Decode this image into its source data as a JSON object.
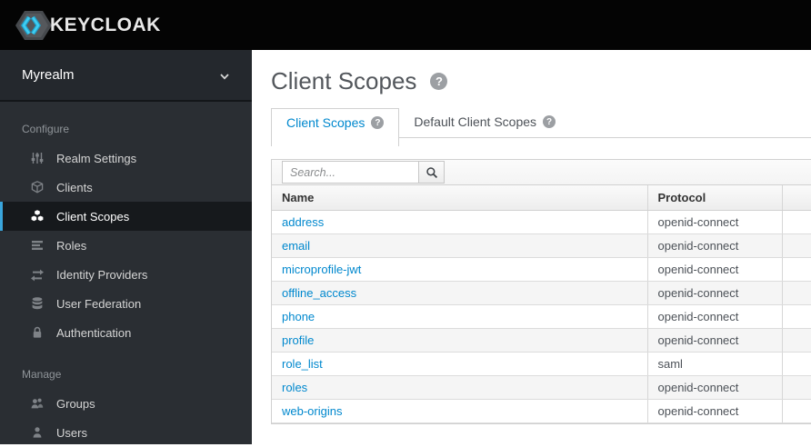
{
  "colors": {
    "accent": "#0088ce",
    "indicator": "#39a5dc",
    "brand_cyan": "#2cc1e9",
    "topbar_bg": "#040404",
    "sidebar_bg": "#2a2e33"
  },
  "topbar": {
    "brand": "KEYCLOAK",
    "logo_icon": "keycloak-hexagon-icon"
  },
  "sidebar": {
    "realm": {
      "name": "Myrealm",
      "chevron_icon": "chevron-down-icon"
    },
    "sections": [
      {
        "label": "Configure",
        "items": [
          {
            "label": "Realm Settings",
            "icon": "sliders-icon",
            "selected": false
          },
          {
            "label": "Clients",
            "icon": "cube-icon",
            "selected": false
          },
          {
            "label": "Client Scopes",
            "icon": "cubes-icon",
            "selected": true
          },
          {
            "label": "Roles",
            "icon": "list-bars-icon",
            "selected": false
          },
          {
            "label": "Identity Providers",
            "icon": "exchange-arrows-icon",
            "selected": false
          },
          {
            "label": "User Federation",
            "icon": "database-icon",
            "selected": false
          },
          {
            "label": "Authentication",
            "icon": "lock-icon",
            "selected": false
          }
        ]
      },
      {
        "label": "Manage",
        "items": [
          {
            "label": "Groups",
            "icon": "users-icon",
            "selected": false
          },
          {
            "label": "Users",
            "icon": "user-icon",
            "selected": false
          }
        ]
      }
    ]
  },
  "main": {
    "title": "Client Scopes",
    "title_help_icon": "help-icon",
    "tabs": [
      {
        "label": "Client Scopes",
        "active": true,
        "help_icon": "help-icon"
      },
      {
        "label": "Default Client Scopes",
        "active": false,
        "help_icon": "help-icon"
      }
    ],
    "search": {
      "placeholder": "Search...",
      "button_icon": "search-icon"
    },
    "table": {
      "columns": [
        "Name",
        "Protocol"
      ],
      "rows": [
        {
          "name": "address",
          "protocol": "openid-connect"
        },
        {
          "name": "email",
          "protocol": "openid-connect"
        },
        {
          "name": "microprofile-jwt",
          "protocol": "openid-connect"
        },
        {
          "name": "offline_access",
          "protocol": "openid-connect"
        },
        {
          "name": "phone",
          "protocol": "openid-connect"
        },
        {
          "name": "profile",
          "protocol": "openid-connect"
        },
        {
          "name": "role_list",
          "protocol": "saml"
        },
        {
          "name": "roles",
          "protocol": "openid-connect"
        },
        {
          "name": "web-origins",
          "protocol": "openid-connect"
        }
      ]
    }
  }
}
